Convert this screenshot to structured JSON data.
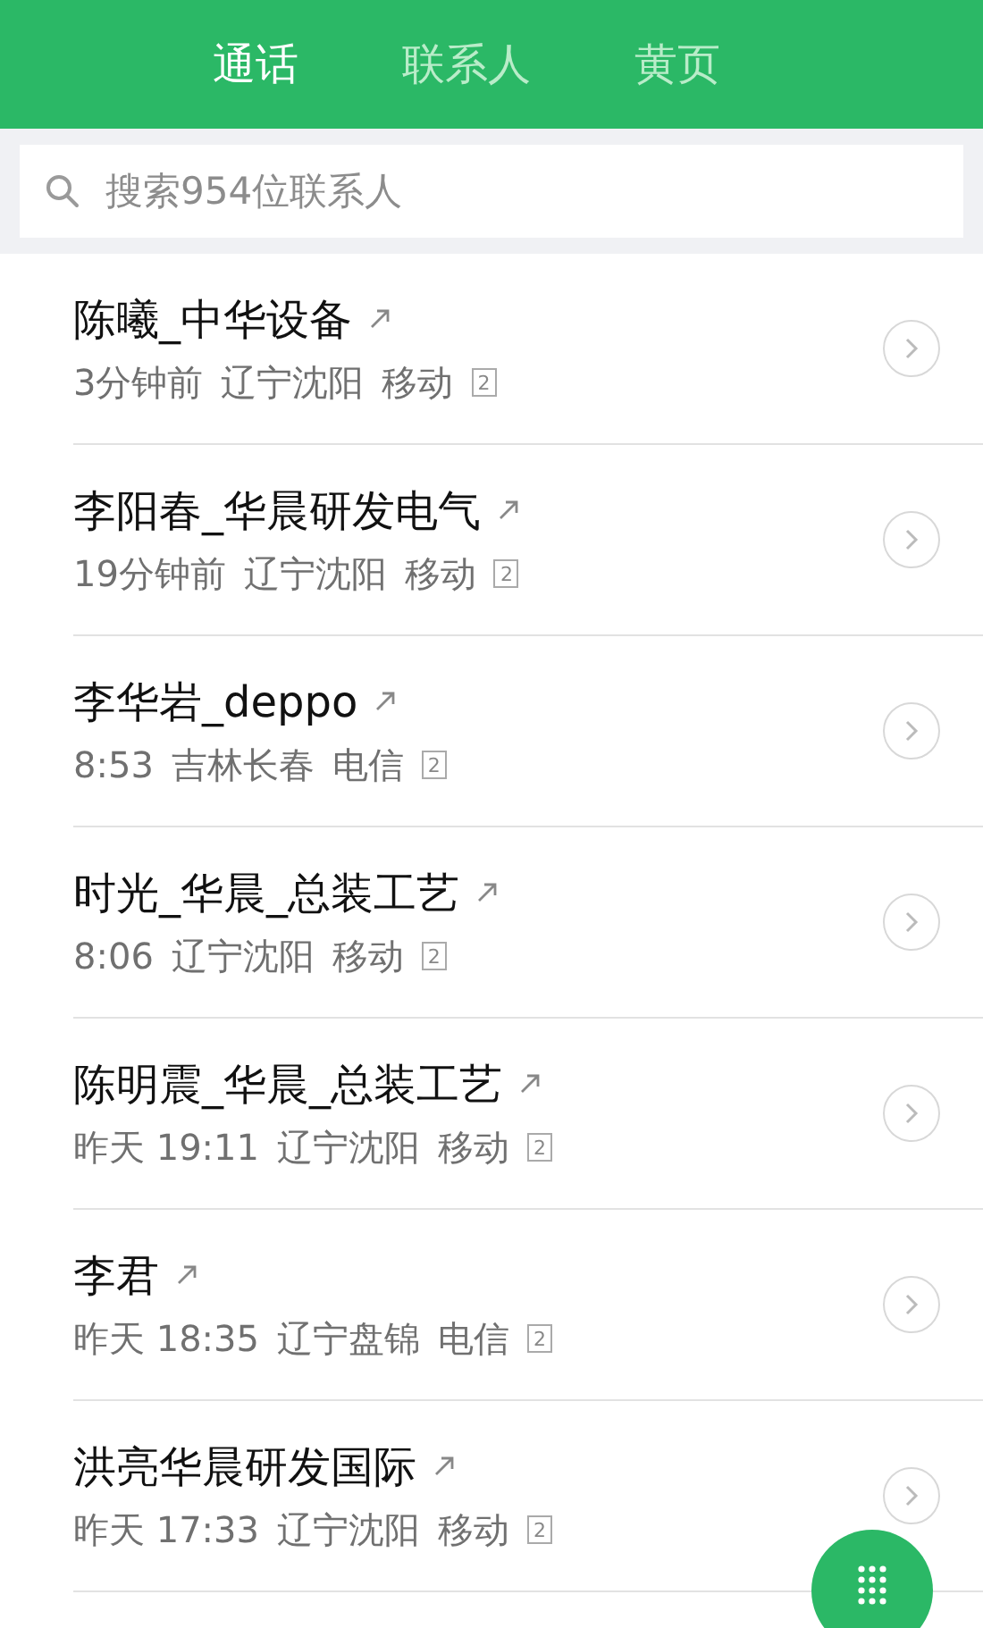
{
  "tabs": [
    {
      "label": "通话",
      "selected": true
    },
    {
      "label": "联系人",
      "selected": false
    },
    {
      "label": "黄页",
      "selected": false
    }
  ],
  "search": {
    "placeholder": "搜索954位联系人"
  },
  "calls": [
    {
      "name": "陈曦_中华设备",
      "time": "3分钟前",
      "location": "辽宁沈阳",
      "carrier": "移动",
      "sim": "2"
    },
    {
      "name": "李阳春_华晨研发电气",
      "time": "19分钟前",
      "location": "辽宁沈阳",
      "carrier": "移动",
      "sim": "2"
    },
    {
      "name": "李华岩_deppo",
      "time": "8:53",
      "location": "吉林长春",
      "carrier": "电信",
      "sim": "2"
    },
    {
      "name": "时光_华晨_总装工艺",
      "time": "8:06",
      "location": "辽宁沈阳",
      "carrier": "移动",
      "sim": "2"
    },
    {
      "name": "陈明震_华晨_总装工艺",
      "time": "昨天 19:11",
      "location": "辽宁沈阳",
      "carrier": "移动",
      "sim": "2"
    },
    {
      "name": "李君",
      "time": "昨天 18:35",
      "location": "辽宁盘锦",
      "carrier": "电信",
      "sim": "2"
    },
    {
      "name": "洪亮华晨研发国际",
      "time": "昨天 17:33",
      "location": "辽宁沈阳",
      "carrier": "移动",
      "sim": "2"
    }
  ]
}
